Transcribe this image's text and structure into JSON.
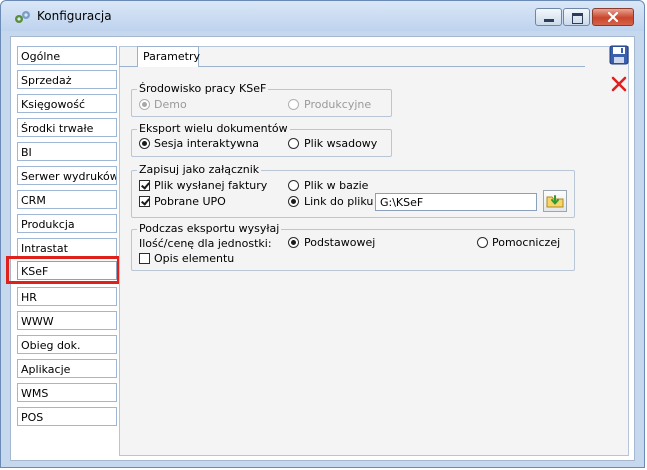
{
  "window": {
    "title": "Konfiguracja"
  },
  "sidebar": {
    "items": [
      {
        "label": "Ogólne"
      },
      {
        "label": "Sprzedaż"
      },
      {
        "label": "Księgowość"
      },
      {
        "label": "Środki trwałe"
      },
      {
        "label": "BI"
      },
      {
        "label": "Serwer wydruków"
      },
      {
        "label": "CRM"
      },
      {
        "label": "Produkcja"
      },
      {
        "label": "Intrastat"
      },
      {
        "label": "KSeF",
        "selected": true
      },
      {
        "label": "HR"
      },
      {
        "label": "WWW"
      },
      {
        "label": "Obieg dok."
      },
      {
        "label": "Aplikacje"
      },
      {
        "label": "WMS"
      },
      {
        "label": "POS"
      }
    ]
  },
  "tabs": [
    {
      "label": "Parametry",
      "active": true
    }
  ],
  "srodowisko": {
    "label": "Środowisko pracy KSeF",
    "options": [
      {
        "label": "Demo",
        "selected": true,
        "enabled": false
      },
      {
        "label": "Produkcyjne",
        "selected": false,
        "enabled": false
      }
    ]
  },
  "eksport": {
    "label": "Eksport wielu dokumentów",
    "options": [
      {
        "label": "Sesja interaktywna",
        "selected": true
      },
      {
        "label": "Plik wsadowy",
        "selected": false
      }
    ]
  },
  "zalacznik": {
    "label": "Zapisuj jako załącznik",
    "checks": [
      {
        "label": "Plik wysłanej faktury",
        "checked": true
      },
      {
        "label": "Pobrane UPO",
        "checked": true
      }
    ],
    "location": [
      {
        "label": "Plik w bazie",
        "selected": false
      },
      {
        "label": "Link do pliku",
        "selected": true
      }
    ],
    "path_value": "G:\\KSeF"
  },
  "podczas": {
    "label": "Podczas eksportu wysyłaj",
    "qty_label": "Ilość/cenę dla jednostki:",
    "options": [
      {
        "label": "Podstawowej",
        "selected": true
      },
      {
        "label": "Pomocniczej",
        "selected": false
      }
    ],
    "opis": {
      "label": "Opis elementu",
      "checked": false
    }
  },
  "colors": {
    "highlight": "#e0201b",
    "titlebar": "#c6d8ee",
    "close_button": "#c9462c"
  },
  "icons": {
    "save": "floppy-disk-icon",
    "cancel": "red-x-icon",
    "browse": "folder-arrow-icon",
    "app": "gears-icon"
  }
}
